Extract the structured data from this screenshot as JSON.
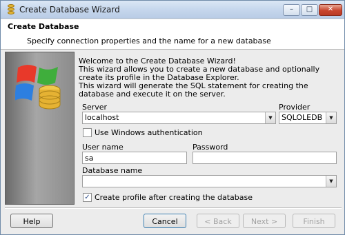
{
  "window": {
    "title": "Create Database Wizard"
  },
  "header": {
    "title": "Create Database",
    "subtitle": "Specify connection properties and the name for a new database"
  },
  "intro": {
    "line1": "Welcome to the Create Database Wizard!\nThis wizard allows you to create a new database and optionally create its profile in the Database Explorer.",
    "line2": "This wizard will generate the SQL statement for creating the database and execute it on the server."
  },
  "server": {
    "label": "Server",
    "value": "localhost"
  },
  "provider": {
    "label": "Provider",
    "value": "SQLOLEDB"
  },
  "windows_auth": {
    "label": "Use Windows authentication",
    "checked": false
  },
  "username": {
    "label": "User name",
    "value": "sa"
  },
  "password": {
    "label": "Password",
    "value": ""
  },
  "database_name": {
    "label": "Database name",
    "value": ""
  },
  "create_profile": {
    "label": "Create profile after creating the database",
    "checked": true,
    "mark": "✓"
  },
  "buttons": {
    "help": "Help",
    "cancel": "Cancel",
    "back": "< Back",
    "next": "Next >",
    "finish": "Finish"
  },
  "title_buttons": {
    "minimize": "–",
    "maximize": "□",
    "close": "✕"
  },
  "colors": {
    "title_bar": "#c5d6ec",
    "close_button": "#c8452e",
    "accent": "#3c7fb1"
  }
}
